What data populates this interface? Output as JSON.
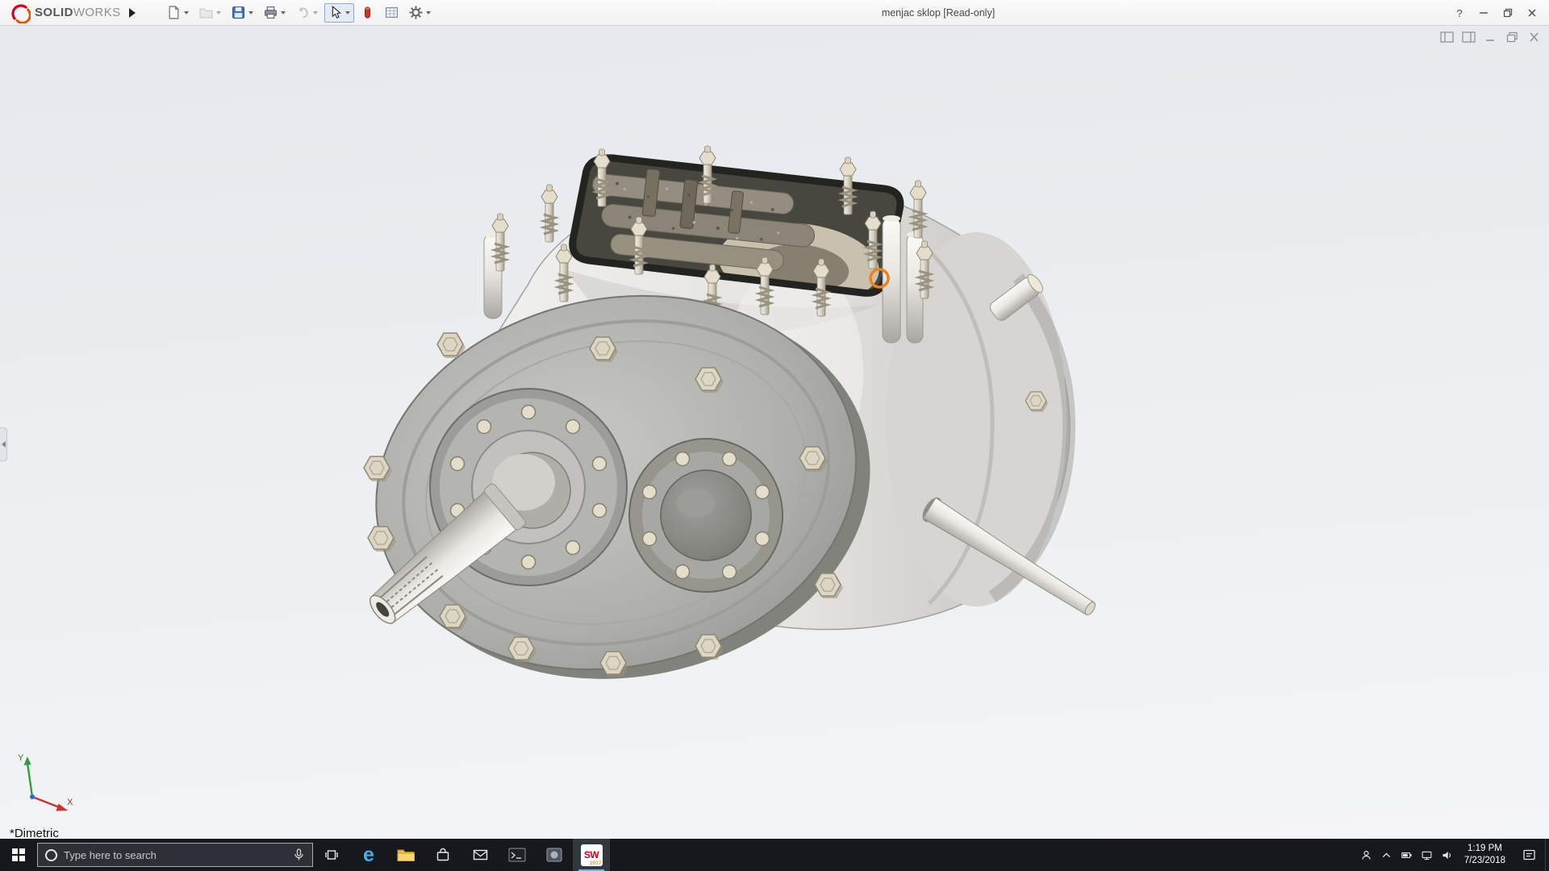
{
  "colors": {
    "accent_orange": "#e8831d"
  },
  "titlebar": {
    "brand_bold": "SOLID",
    "brand_light": "WORKS",
    "document_title": "menjac sklop [Read-only]",
    "help_label": "?"
  },
  "viewport": {
    "orientation_label": "*Dimetric",
    "axis_x": "X",
    "axis_y": "Y"
  },
  "taskbar": {
    "search_placeholder": "Type here to search",
    "edge_glyph": "e",
    "sw_letters": "SW",
    "sw_year": "2017",
    "time": "1:19 PM",
    "date": "7/23/2018"
  }
}
